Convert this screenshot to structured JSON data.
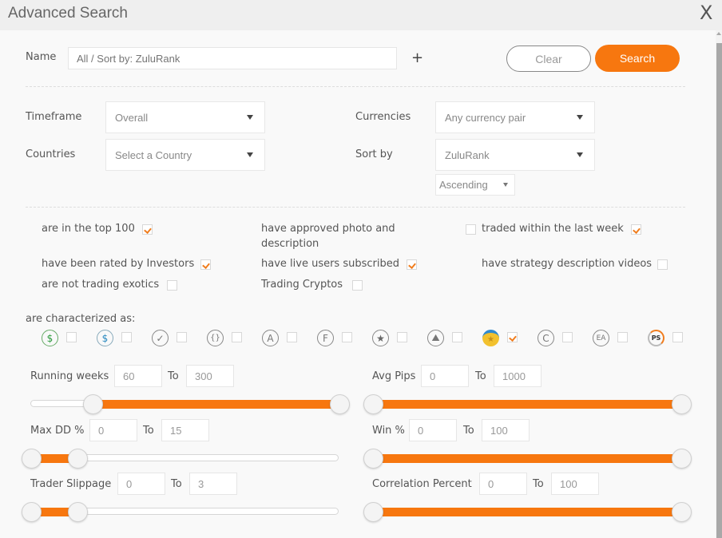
{
  "window": {
    "title": "Advanced Search",
    "close_label": "X"
  },
  "name_row": {
    "label": "Name",
    "placeholder": "All / Sort by: ZuluRank",
    "add_label": "+",
    "clear_label": "Clear",
    "search_label": "Search"
  },
  "filters": {
    "timeframe": {
      "label": "Timeframe",
      "value": "Overall"
    },
    "countries": {
      "label": "Countries",
      "value": "Select a Country"
    },
    "currencies": {
      "label": "Currencies",
      "value": "Any currency pair"
    },
    "sort_by": {
      "label": "Sort by",
      "value": "ZuluRank",
      "order": "Ascending"
    }
  },
  "checkboxes": [
    {
      "label": "are in the top 100",
      "checked": true
    },
    {
      "label": "have approved photo and description",
      "label_line1": "have approved photo and",
      "label_line2": "description",
      "checked": false
    },
    {
      "label": "traded within the last week",
      "checked": true
    },
    {
      "label": "have been rated by Investors",
      "checked": true
    },
    {
      "label": "have live users subscribed",
      "checked": true
    },
    {
      "label": "have strategy description videos",
      "checked": false
    },
    {
      "label": "are not trading exotics",
      "checked": false
    },
    {
      "label": "Trading Cryptos",
      "checked": false
    }
  ],
  "characterized": {
    "label": "are characterized as:",
    "items": [
      {
        "icon": "green-dollar-icon",
        "glyph": "$",
        "checked": false
      },
      {
        "icon": "blue-dollar-icon",
        "glyph": "$",
        "checked": false
      },
      {
        "icon": "verified-badge-icon",
        "glyph": "✓",
        "checked": false
      },
      {
        "icon": "braces-icon",
        "glyph": "{}",
        "checked": false
      },
      {
        "icon": "letter-a-icon",
        "glyph": "A",
        "checked": false
      },
      {
        "icon": "letter-f-icon",
        "glyph": "F",
        "checked": false
      },
      {
        "icon": "star-icon",
        "glyph": "★",
        "checked": false
      },
      {
        "icon": "climber-icon",
        "glyph": "⛰",
        "checked": false
      },
      {
        "icon": "medal-icon",
        "glyph": "★",
        "checked": true
      },
      {
        "icon": "copyright-c-icon",
        "glyph": "C",
        "checked": false
      },
      {
        "icon": "ea-icon",
        "glyph": "EA",
        "checked": false
      },
      {
        "icon": "ps-icon",
        "glyph": "PS",
        "checked": false
      }
    ]
  },
  "ranges": {
    "to_label": "To",
    "running_weeks": {
      "label": "Running weeks",
      "from": "60",
      "to": "300",
      "from_frac": 0.2,
      "to_frac": 1.0
    },
    "avg_pips": {
      "label": "Avg Pips",
      "from": "0",
      "to": "1000",
      "from_frac": 0.0,
      "to_frac": 1.0
    },
    "max_dd": {
      "label": "Max DD %",
      "from": "0",
      "to": "15",
      "from_frac": 0.0,
      "to_frac": 0.15
    },
    "win_pct": {
      "label": "Win %",
      "from": "0",
      "to": "100",
      "from_frac": 0.0,
      "to_frac": 1.0
    },
    "slippage": {
      "label": "Trader Slippage",
      "from": "0",
      "to": "3",
      "from_frac": 0.0,
      "to_frac": 0.15
    },
    "correlation": {
      "label": "Correlation Percent",
      "from": "0",
      "to": "100",
      "from_frac": 0.0,
      "to_frac": 1.0
    }
  },
  "colors": {
    "accent": "#f7770f",
    "check": "#f07d1e"
  }
}
